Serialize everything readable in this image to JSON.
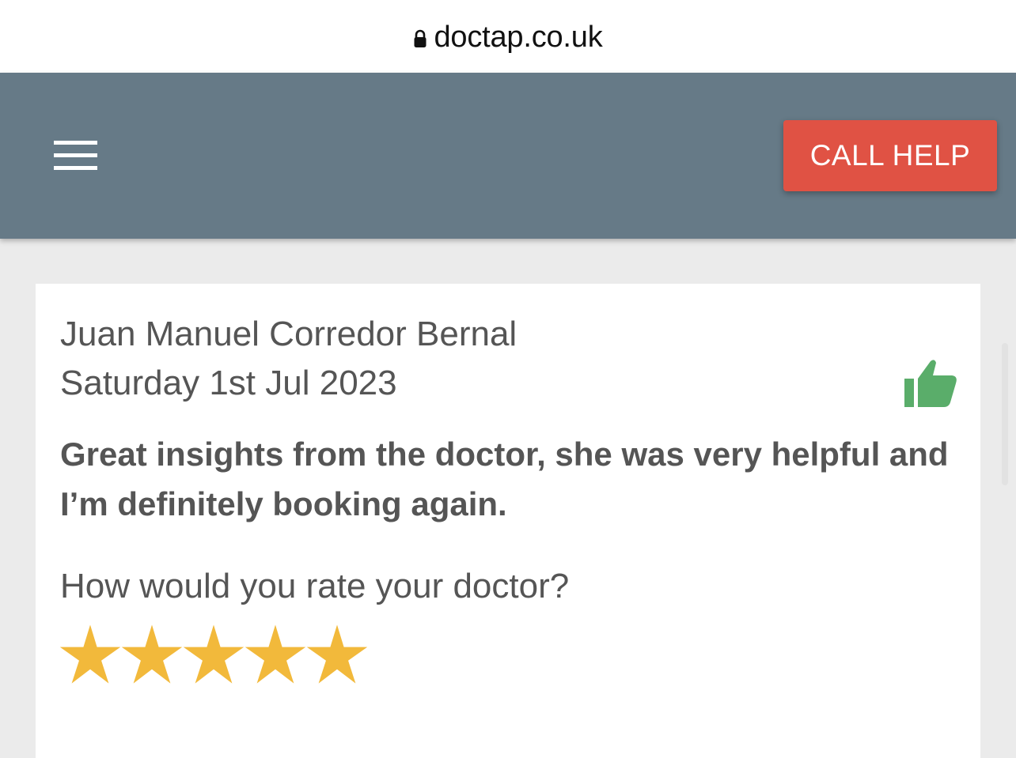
{
  "browser": {
    "url": "doctap.co.uk",
    "lock_icon": "lock-icon"
  },
  "header": {
    "menu_icon": "hamburger-menu-icon",
    "call_help_label": "CALL HELP",
    "bar_color": "#667a87",
    "button_color": "#e05244"
  },
  "review": {
    "reviewer_name": "Juan Manuel Corredor Bernal",
    "date": "Saturday 1st Jul 2023",
    "sentiment_icon": "thumbs-up-icon",
    "sentiment_color": "#5aad6a",
    "comment": "Great insights from the doctor, she was very helpful and I’m definitely booking again.",
    "rating_question": "How would you rate your doctor?",
    "rating": 5,
    "rating_max": 5,
    "star_color": "#f2b93b"
  }
}
